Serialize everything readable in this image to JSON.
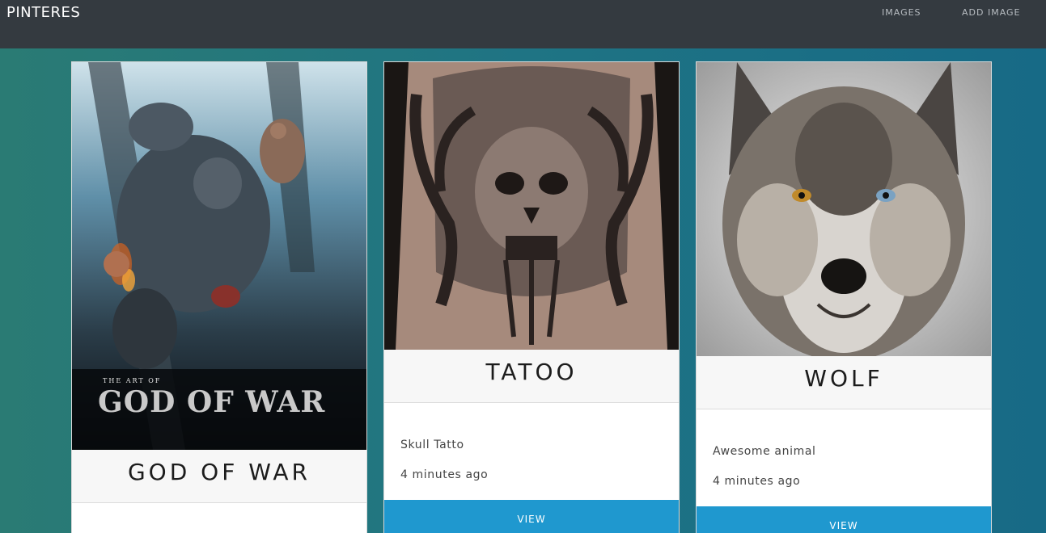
{
  "navbar": {
    "brand": "PINTERES",
    "links": [
      "IMAGES",
      "ADD IMAGE"
    ]
  },
  "cards": [
    {
      "title": "GOD OF WAR",
      "image_text": {
        "line1": "THE ART OF",
        "logo": "GOD OF WAR"
      }
    },
    {
      "title": "TATOO",
      "description": "Skull Tatto",
      "time": "4 minutes ago",
      "button": "VIEW"
    },
    {
      "title": "WOLF",
      "description": "Awesome animal",
      "time": "4 minutes ago",
      "button": "VIEW"
    }
  ],
  "colors": {
    "navbar": "#343a40",
    "button": "#1f98cf",
    "bg_left": "#2a7b74",
    "bg_right": "#176a86"
  }
}
